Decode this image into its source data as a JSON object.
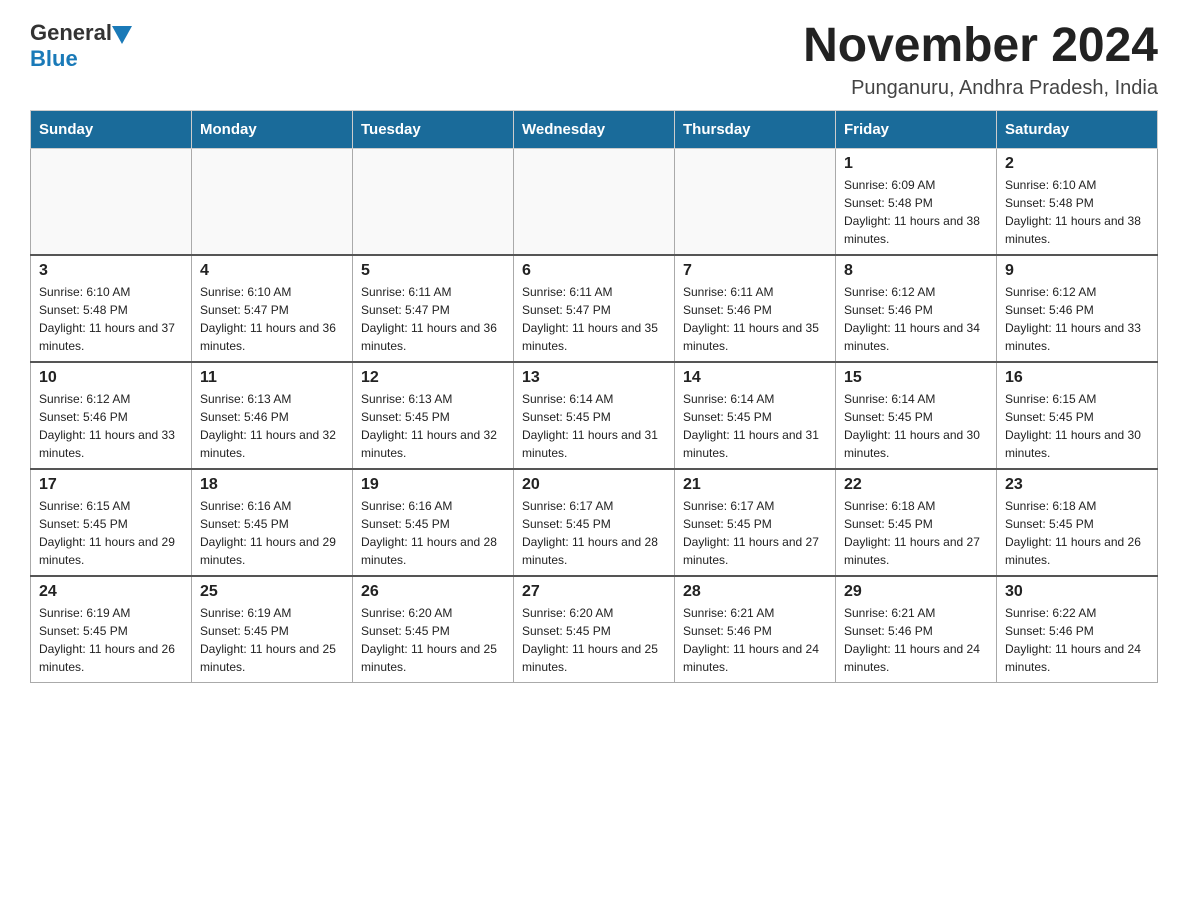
{
  "header": {
    "logo_general": "General",
    "logo_blue": "Blue",
    "month_title": "November 2024",
    "location": "Punganuru, Andhra Pradesh, India"
  },
  "calendar": {
    "days_of_week": [
      "Sunday",
      "Monday",
      "Tuesday",
      "Wednesday",
      "Thursday",
      "Friday",
      "Saturday"
    ],
    "weeks": [
      [
        {
          "day": "",
          "info": ""
        },
        {
          "day": "",
          "info": ""
        },
        {
          "day": "",
          "info": ""
        },
        {
          "day": "",
          "info": ""
        },
        {
          "day": "",
          "info": ""
        },
        {
          "day": "1",
          "info": "Sunrise: 6:09 AM\nSunset: 5:48 PM\nDaylight: 11 hours and 38 minutes."
        },
        {
          "day": "2",
          "info": "Sunrise: 6:10 AM\nSunset: 5:48 PM\nDaylight: 11 hours and 38 minutes."
        }
      ],
      [
        {
          "day": "3",
          "info": "Sunrise: 6:10 AM\nSunset: 5:48 PM\nDaylight: 11 hours and 37 minutes."
        },
        {
          "day": "4",
          "info": "Sunrise: 6:10 AM\nSunset: 5:47 PM\nDaylight: 11 hours and 36 minutes."
        },
        {
          "day": "5",
          "info": "Sunrise: 6:11 AM\nSunset: 5:47 PM\nDaylight: 11 hours and 36 minutes."
        },
        {
          "day": "6",
          "info": "Sunrise: 6:11 AM\nSunset: 5:47 PM\nDaylight: 11 hours and 35 minutes."
        },
        {
          "day": "7",
          "info": "Sunrise: 6:11 AM\nSunset: 5:46 PM\nDaylight: 11 hours and 35 minutes."
        },
        {
          "day": "8",
          "info": "Sunrise: 6:12 AM\nSunset: 5:46 PM\nDaylight: 11 hours and 34 minutes."
        },
        {
          "day": "9",
          "info": "Sunrise: 6:12 AM\nSunset: 5:46 PM\nDaylight: 11 hours and 33 minutes."
        }
      ],
      [
        {
          "day": "10",
          "info": "Sunrise: 6:12 AM\nSunset: 5:46 PM\nDaylight: 11 hours and 33 minutes."
        },
        {
          "day": "11",
          "info": "Sunrise: 6:13 AM\nSunset: 5:46 PM\nDaylight: 11 hours and 32 minutes."
        },
        {
          "day": "12",
          "info": "Sunrise: 6:13 AM\nSunset: 5:45 PM\nDaylight: 11 hours and 32 minutes."
        },
        {
          "day": "13",
          "info": "Sunrise: 6:14 AM\nSunset: 5:45 PM\nDaylight: 11 hours and 31 minutes."
        },
        {
          "day": "14",
          "info": "Sunrise: 6:14 AM\nSunset: 5:45 PM\nDaylight: 11 hours and 31 minutes."
        },
        {
          "day": "15",
          "info": "Sunrise: 6:14 AM\nSunset: 5:45 PM\nDaylight: 11 hours and 30 minutes."
        },
        {
          "day": "16",
          "info": "Sunrise: 6:15 AM\nSunset: 5:45 PM\nDaylight: 11 hours and 30 minutes."
        }
      ],
      [
        {
          "day": "17",
          "info": "Sunrise: 6:15 AM\nSunset: 5:45 PM\nDaylight: 11 hours and 29 minutes."
        },
        {
          "day": "18",
          "info": "Sunrise: 6:16 AM\nSunset: 5:45 PM\nDaylight: 11 hours and 29 minutes."
        },
        {
          "day": "19",
          "info": "Sunrise: 6:16 AM\nSunset: 5:45 PM\nDaylight: 11 hours and 28 minutes."
        },
        {
          "day": "20",
          "info": "Sunrise: 6:17 AM\nSunset: 5:45 PM\nDaylight: 11 hours and 28 minutes."
        },
        {
          "day": "21",
          "info": "Sunrise: 6:17 AM\nSunset: 5:45 PM\nDaylight: 11 hours and 27 minutes."
        },
        {
          "day": "22",
          "info": "Sunrise: 6:18 AM\nSunset: 5:45 PM\nDaylight: 11 hours and 27 minutes."
        },
        {
          "day": "23",
          "info": "Sunrise: 6:18 AM\nSunset: 5:45 PM\nDaylight: 11 hours and 26 minutes."
        }
      ],
      [
        {
          "day": "24",
          "info": "Sunrise: 6:19 AM\nSunset: 5:45 PM\nDaylight: 11 hours and 26 minutes."
        },
        {
          "day": "25",
          "info": "Sunrise: 6:19 AM\nSunset: 5:45 PM\nDaylight: 11 hours and 25 minutes."
        },
        {
          "day": "26",
          "info": "Sunrise: 6:20 AM\nSunset: 5:45 PM\nDaylight: 11 hours and 25 minutes."
        },
        {
          "day": "27",
          "info": "Sunrise: 6:20 AM\nSunset: 5:45 PM\nDaylight: 11 hours and 25 minutes."
        },
        {
          "day": "28",
          "info": "Sunrise: 6:21 AM\nSunset: 5:46 PM\nDaylight: 11 hours and 24 minutes."
        },
        {
          "day": "29",
          "info": "Sunrise: 6:21 AM\nSunset: 5:46 PM\nDaylight: 11 hours and 24 minutes."
        },
        {
          "day": "30",
          "info": "Sunrise: 6:22 AM\nSunset: 5:46 PM\nDaylight: 11 hours and 24 minutes."
        }
      ]
    ]
  }
}
